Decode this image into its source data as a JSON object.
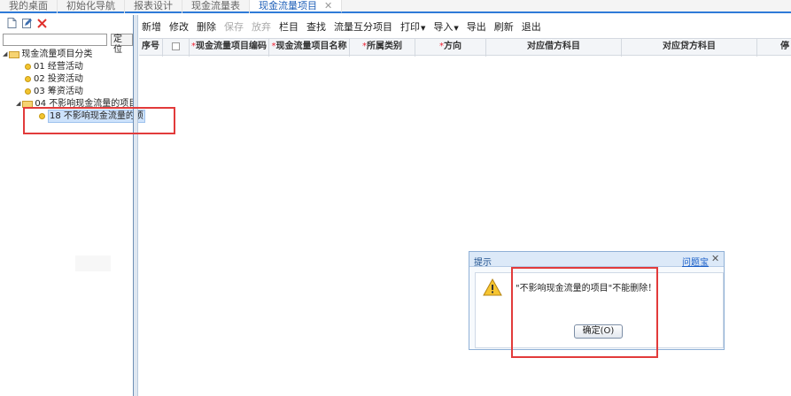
{
  "tabs": [
    {
      "label": "我的桌面",
      "active": false
    },
    {
      "label": "初始化导航",
      "active": false
    },
    {
      "label": "报表设计",
      "active": false
    },
    {
      "label": "现金流量表",
      "active": false
    },
    {
      "label": "现金流量项目",
      "active": true,
      "close": "✕"
    }
  ],
  "left": {
    "search_value": "",
    "locate_label": "定位",
    "tree": {
      "root": "现金流量项目分类",
      "items": [
        {
          "label": "01 经营活动"
        },
        {
          "label": "02 投资活动"
        },
        {
          "label": "03 筹资活动"
        },
        {
          "label": "04 不影响现金流量的项目",
          "children": [
            {
              "label": "18 不影响现金流量的项"
            }
          ]
        }
      ]
    }
  },
  "toolbar": {
    "items": [
      {
        "label": "新增",
        "disabled": false
      },
      {
        "label": "修改",
        "disabled": false
      },
      {
        "label": "删除",
        "disabled": false
      },
      {
        "label": "保存",
        "disabled": true
      },
      {
        "label": "放弃",
        "disabled": true
      },
      {
        "label": "栏目",
        "disabled": false
      },
      {
        "label": "查找",
        "disabled": false
      },
      {
        "label": "流量互分项目",
        "disabled": false
      },
      {
        "label": "打印",
        "disabled": false,
        "dropdown": true
      },
      {
        "label": "导入",
        "disabled": false,
        "dropdown": true
      },
      {
        "label": "导出",
        "disabled": false
      },
      {
        "label": "刷新",
        "disabled": false
      },
      {
        "label": "退出",
        "disabled": false
      }
    ]
  },
  "grid": {
    "columns": [
      {
        "label": "序号",
        "required": false
      },
      {
        "label": "",
        "checkbox": true
      },
      {
        "label": "现金流量项目编码",
        "required": true
      },
      {
        "label": "现金流量项目名称",
        "required": true
      },
      {
        "label": "所属类别",
        "required": true
      },
      {
        "label": "方向",
        "required": true
      },
      {
        "label": "对应借方科目",
        "required": false
      },
      {
        "label": "对应贷方科目",
        "required": false
      },
      {
        "label": "停",
        "required": false
      }
    ],
    "required_mark": "*"
  },
  "dialog": {
    "title": "提示",
    "help_link": "问题宝",
    "close": "✕",
    "message": "\"不影响现金流量的项目\"不能删除！",
    "ok_label": "确定(O)"
  },
  "colors": {
    "accent": "#2f7bd8",
    "highlight": "#e23b3b",
    "required": "#e22233"
  }
}
